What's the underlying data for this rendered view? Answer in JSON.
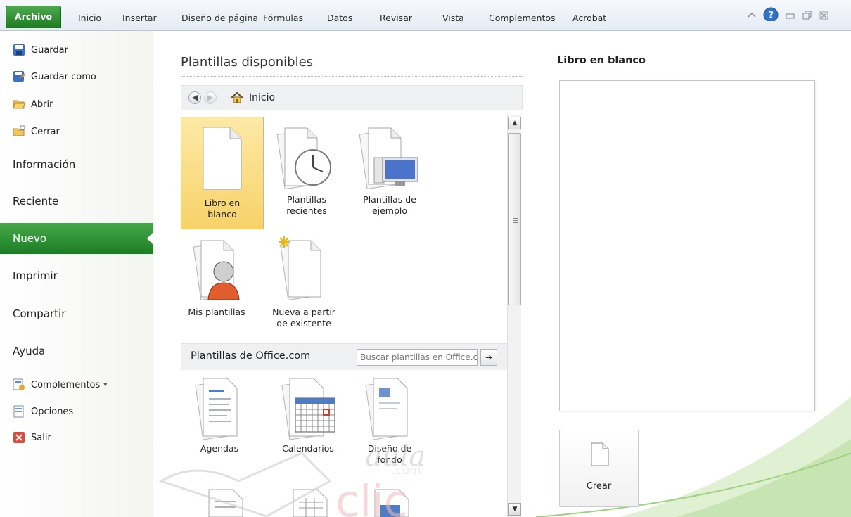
{
  "ribbon": {
    "tabs": [
      "Archivo",
      "Inicio",
      "Insertar",
      "Diseño de página",
      "Fórmulas",
      "Datos",
      "Revisar",
      "Vista",
      "Complementos",
      "Acrobat"
    ],
    "window_controls": [
      "minimize-ribbon-icon",
      "help-icon",
      "restore-icon",
      "maximize-icon",
      "close-icon"
    ]
  },
  "backstage": {
    "commands_top": [
      {
        "label": "Guardar",
        "icon": "save-icon"
      },
      {
        "label": "Guardar como",
        "icon": "save-as-icon"
      },
      {
        "label": "Abrir",
        "icon": "open-folder-icon"
      },
      {
        "label": "Cerrar",
        "icon": "close-folder-icon"
      }
    ],
    "tabs": [
      "Información",
      "Reciente",
      "Nuevo",
      "Imprimir",
      "Compartir",
      "Ayuda"
    ],
    "active_tab": "Nuevo",
    "commands_bottom": [
      {
        "label": "Complementos",
        "icon": "addins-icon",
        "dropdown": "▾"
      },
      {
        "label": "Opciones",
        "icon": "options-icon"
      },
      {
        "label": "Salir",
        "icon": "exit-icon"
      }
    ]
  },
  "templates": {
    "title": "Plantillas disponibles",
    "breadcrumb_home": "Inicio",
    "tiles": [
      {
        "label_l1": "Libro en",
        "label_l2": "blanco",
        "selected": true
      },
      {
        "label_l1": "Plantillas",
        "label_l2": "recientes",
        "selected": false
      },
      {
        "label_l1": "Plantillas de",
        "label_l2": "ejemplo",
        "selected": false
      },
      {
        "label_l1": "Mis plantillas",
        "label_l2": "",
        "selected": false
      },
      {
        "label_l1": "Nueva a partir",
        "label_l2": "de existente",
        "selected": false
      }
    ],
    "office_label": "Plantillas de Office.com",
    "office_search_placeholder": "Buscar plantillas en Office.com",
    "office_tiles": [
      {
        "label_l1": "Agendas",
        "label_l2": ""
      },
      {
        "label_l1": "Calendarios",
        "label_l2": ""
      },
      {
        "label_l1": "Diseño de",
        "label_l2": "fondo"
      }
    ]
  },
  "preview": {
    "title": "Libro en blanco",
    "create_label": "Crear"
  },
  "watermark": {
    "line1": "aula",
    "line2": "clic",
    "suffix": ".com"
  },
  "colors": {
    "accent_green": "#1e7b22",
    "selection_gold": "#f7d269"
  }
}
